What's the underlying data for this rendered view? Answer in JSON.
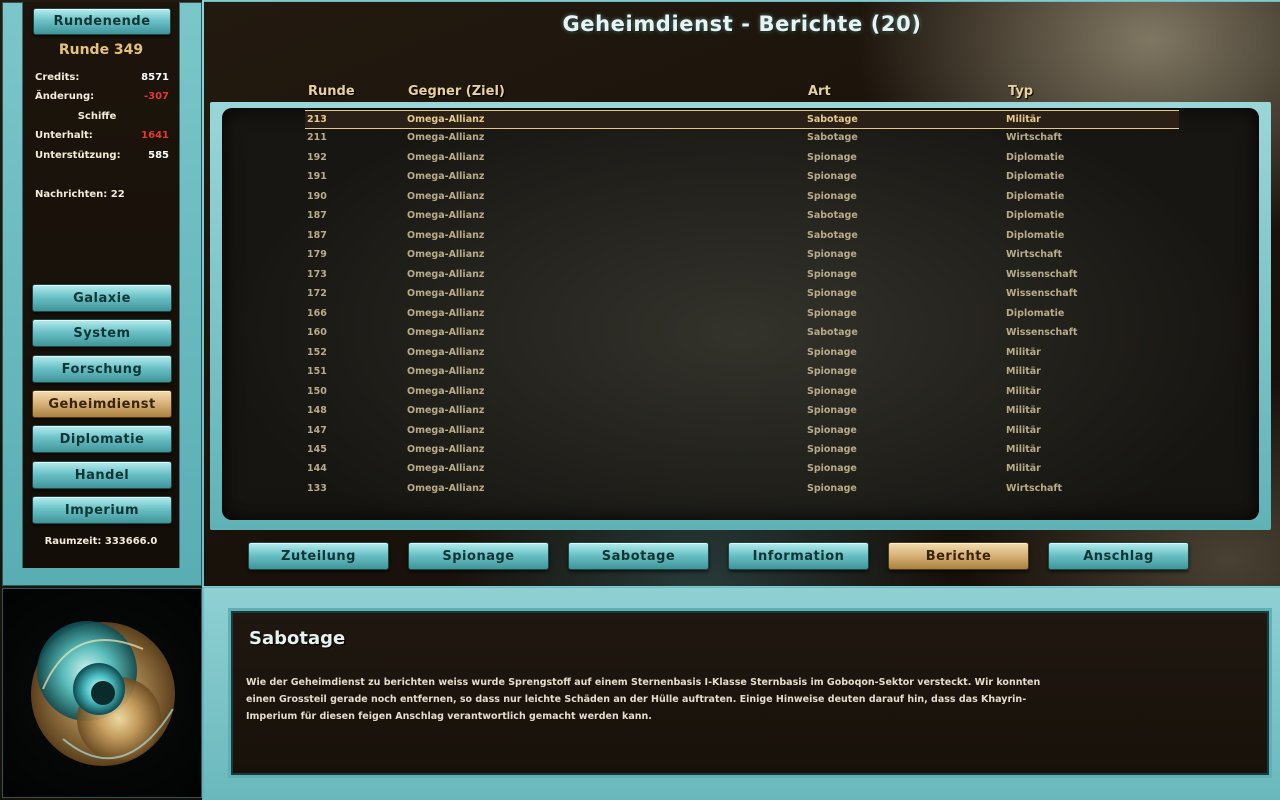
{
  "sidebar": {
    "end_turn_label": "Rundenende",
    "round_label": "Runde 349",
    "stats": [
      {
        "label": "Credits:",
        "value": "8571",
        "color": "#ffffff"
      },
      {
        "label": "Änderung:",
        "value": "-307",
        "color": "#e23a2a"
      },
      {
        "label": "Schiffe",
        "value": "",
        "color": "#ffffff"
      },
      {
        "label": "Unterhalt:",
        "value": "1641",
        "color": "#e23a2a"
      },
      {
        "label": "Unterstützung:",
        "value": "585",
        "color": "#ffffff"
      }
    ],
    "messages_label": "Nachrichten: 22",
    "nav": [
      {
        "label": "Galaxie",
        "active": false
      },
      {
        "label": "System",
        "active": false
      },
      {
        "label": "Forschung",
        "active": false
      },
      {
        "label": "Geheimdienst",
        "active": true
      },
      {
        "label": "Diplomatie",
        "active": false
      },
      {
        "label": "Handel",
        "active": false
      },
      {
        "label": "Imperium",
        "active": false
      }
    ],
    "spacetime_label": "Raumzeit: 333666.0"
  },
  "header": {
    "title": "Geheimdienst - Berichte (20)"
  },
  "table": {
    "columns": [
      "Runde",
      "Gegner (Ziel)",
      "Art",
      "Typ"
    ],
    "selected_index": 0,
    "rows": [
      [
        "213",
        "Omega-Allianz",
        "Sabotage",
        "Militär"
      ],
      [
        "211",
        "Omega-Allianz",
        "Sabotage",
        "Wirtschaft"
      ],
      [
        "192",
        "Omega-Allianz",
        "Spionage",
        "Diplomatie"
      ],
      [
        "191",
        "Omega-Allianz",
        "Spionage",
        "Diplomatie"
      ],
      [
        "190",
        "Omega-Allianz",
        "Spionage",
        "Diplomatie"
      ],
      [
        "187",
        "Omega-Allianz",
        "Sabotage",
        "Diplomatie"
      ],
      [
        "187",
        "Omega-Allianz",
        "Sabotage",
        "Diplomatie"
      ],
      [
        "179",
        "Omega-Allianz",
        "Spionage",
        "Wirtschaft"
      ],
      [
        "173",
        "Omega-Allianz",
        "Spionage",
        "Wissenschaft"
      ],
      [
        "172",
        "Omega-Allianz",
        "Spionage",
        "Wissenschaft"
      ],
      [
        "166",
        "Omega-Allianz",
        "Spionage",
        "Diplomatie"
      ],
      [
        "160",
        "Omega-Allianz",
        "Sabotage",
        "Wissenschaft"
      ],
      [
        "152",
        "Omega-Allianz",
        "Spionage",
        "Militär"
      ],
      [
        "151",
        "Omega-Allianz",
        "Spionage",
        "Militär"
      ],
      [
        "150",
        "Omega-Allianz",
        "Spionage",
        "Militär"
      ],
      [
        "148",
        "Omega-Allianz",
        "Spionage",
        "Militär"
      ],
      [
        "147",
        "Omega-Allianz",
        "Spionage",
        "Militär"
      ],
      [
        "145",
        "Omega-Allianz",
        "Spionage",
        "Militär"
      ],
      [
        "144",
        "Omega-Allianz",
        "Spionage",
        "Militär"
      ],
      [
        "133",
        "Omega-Allianz",
        "Spionage",
        "Wirtschaft"
      ]
    ]
  },
  "tabs": [
    {
      "label": "Zuteilung",
      "active": false
    },
    {
      "label": "Spionage",
      "active": false
    },
    {
      "label": "Sabotage",
      "active": false
    },
    {
      "label": "Information",
      "active": false
    },
    {
      "label": "Berichte",
      "active": true
    },
    {
      "label": "Anschlag",
      "active": false
    }
  ],
  "report": {
    "title": "Sabotage",
    "lines": [
      "Wie der Geheimdienst zu berichten weiss wurde Sprengstoff auf einem Sternenbasis I-Klasse Sternbasis im Goboqon-Sektor versteckt. Wir konnten",
      "einen Grossteil gerade noch entfernen, so dass nur leichte Schäden an der Hülle auftraten. Einige Hinweise deuten darauf hin, dass das Khayrin-",
      "Imperium für diesen feigen Anschlag verantwortlich gemacht werden kann."
    ]
  }
}
